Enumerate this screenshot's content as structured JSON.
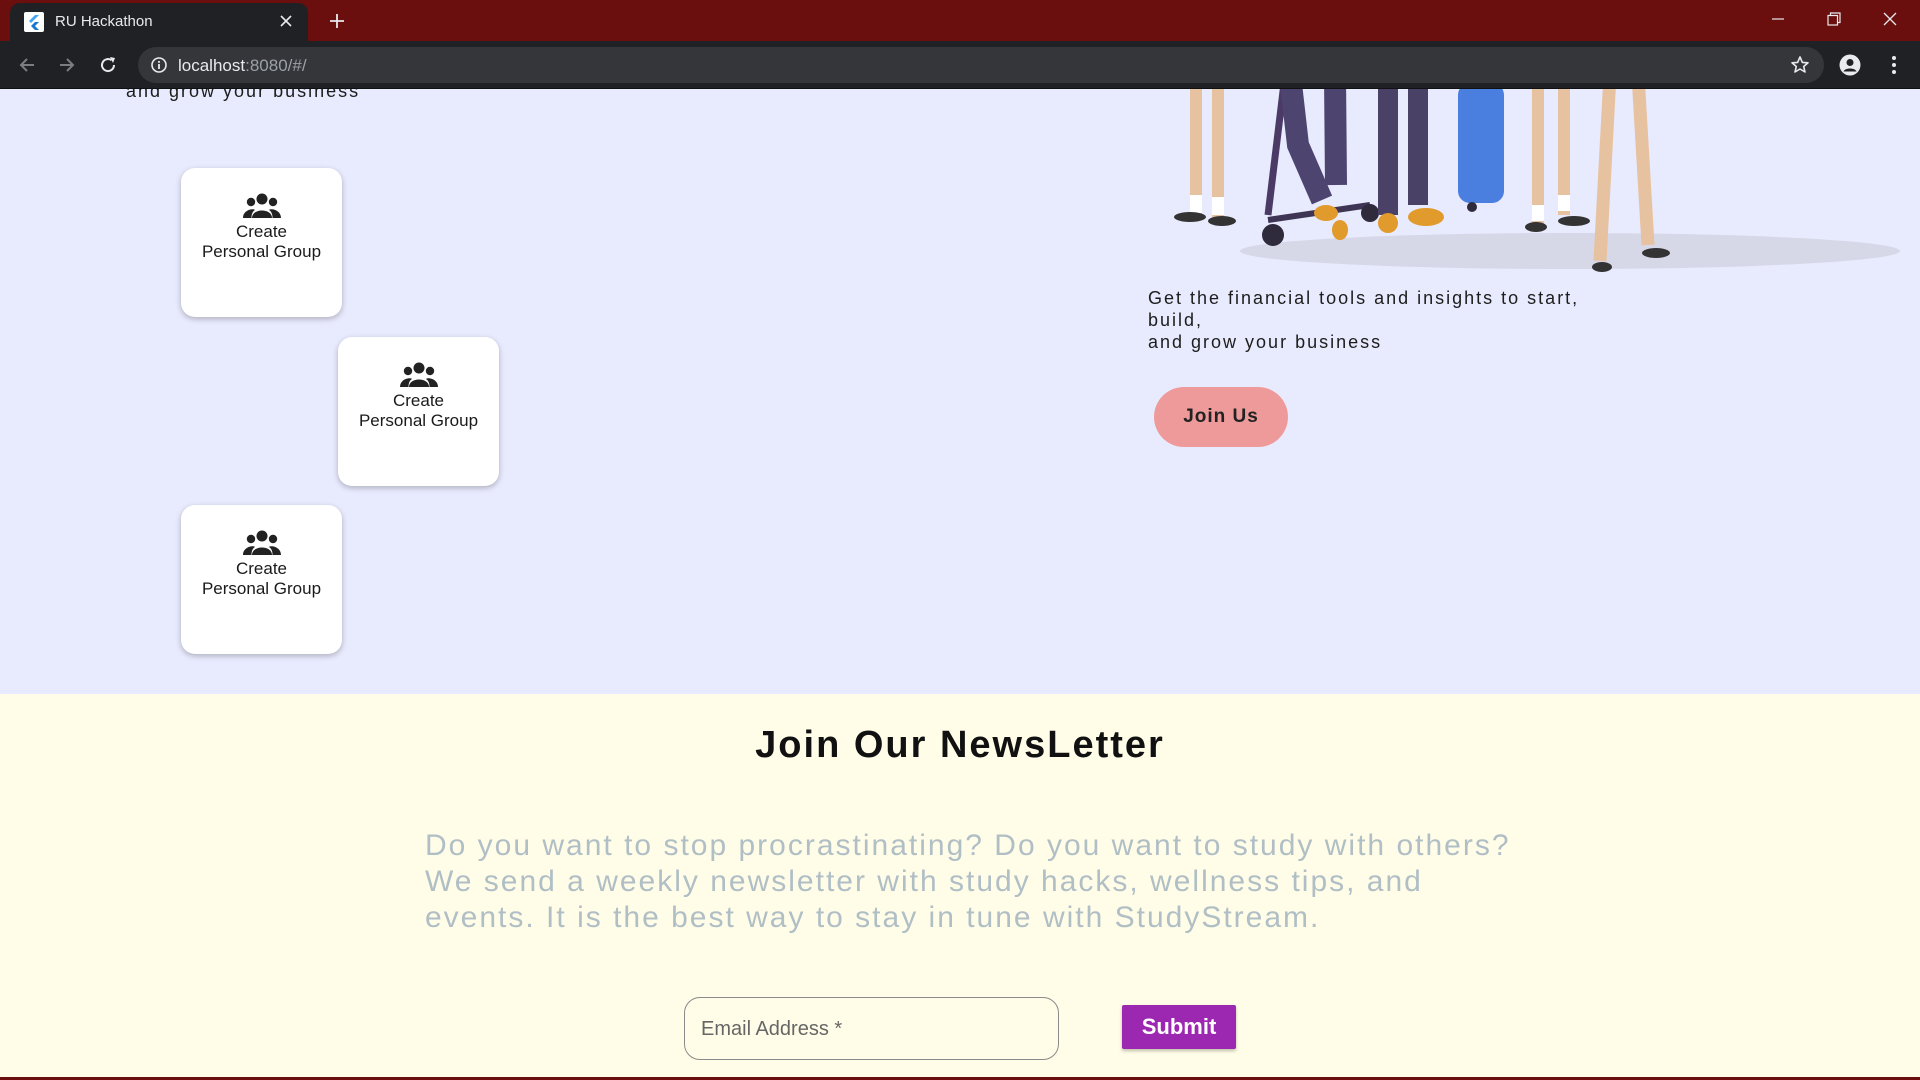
{
  "browser": {
    "tab_title": "RU Hackathon",
    "url_host": "localhost",
    "url_rest": ":8080/#/"
  },
  "hero": {
    "cut_text": "and grow your business",
    "cards": [
      {
        "label_line1": "Create",
        "label_line2": "Personal Group",
        "icon": "groups-icon"
      },
      {
        "label_line1": "Create",
        "label_line2": "Personal Group",
        "icon": "groups-icon"
      },
      {
        "label_line1": "Create",
        "label_line2": "Personal Group",
        "icon": "groups-icon"
      }
    ],
    "tagline_line1": "Get the financial tools and insights to start,",
    "tagline_line2": "build,",
    "tagline_line3": "and grow your business",
    "join_label": "Join Us",
    "join_color": "#ef9a9a"
  },
  "newsletter": {
    "title": "Join Our NewsLetter",
    "description": "Do you want to stop procrastinating? Do you want to study with others? We send a weekly newsletter with study hacks, wellness tips, and events. It is the best way to stay in tune with StudyStream.",
    "email_placeholder": "Email Address *",
    "submit_label": "Submit",
    "submit_color": "#9c27b0"
  },
  "colors": {
    "hero_bg": "#e8eafd",
    "newsletter_bg": "#fffde7",
    "tabbar": "#6a0e0e"
  }
}
